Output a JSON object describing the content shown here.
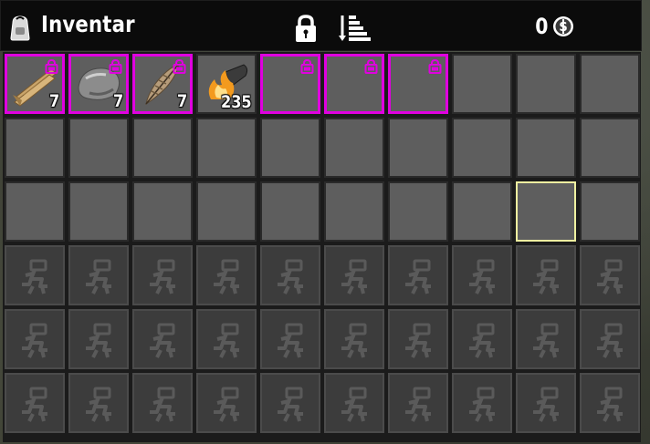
{
  "header": {
    "title": "Inventar",
    "currency_amount": "0",
    "bag_icon": "backpack-icon",
    "lock_icon": "padlock-icon",
    "sort_icon": "sort-stack-icon",
    "coin_icon": "dukes-coin-icon"
  },
  "colors": {
    "lock_border": "#e000e0",
    "selected_border": "#eef0a0",
    "slot_fill": "#5e5e5e",
    "locked_row_fill": "#3c3c3c"
  },
  "grid": {
    "columns": 10,
    "rows": 6,
    "unlocked_rows": 3,
    "selected_slot": 28,
    "items": [
      {
        "slot": 0,
        "name": "wood",
        "icon": "wood-planks-icon",
        "count": "7",
        "locked": true
      },
      {
        "slot": 1,
        "name": "stone",
        "icon": "stone-rock-icon",
        "count": "7",
        "locked": true
      },
      {
        "slot": 2,
        "name": "feather",
        "icon": "feather-icon",
        "count": "7",
        "locked": true
      },
      {
        "slot": 3,
        "name": "torch",
        "icon": "torch-fire-icon",
        "count": "235",
        "locked": false
      },
      {
        "slot": 4,
        "name": "",
        "icon": "",
        "count": "",
        "locked": true
      },
      {
        "slot": 5,
        "name": "",
        "icon": "",
        "count": "",
        "locked": true
      },
      {
        "slot": 6,
        "name": "",
        "icon": "",
        "count": "",
        "locked": true
      }
    ]
  }
}
